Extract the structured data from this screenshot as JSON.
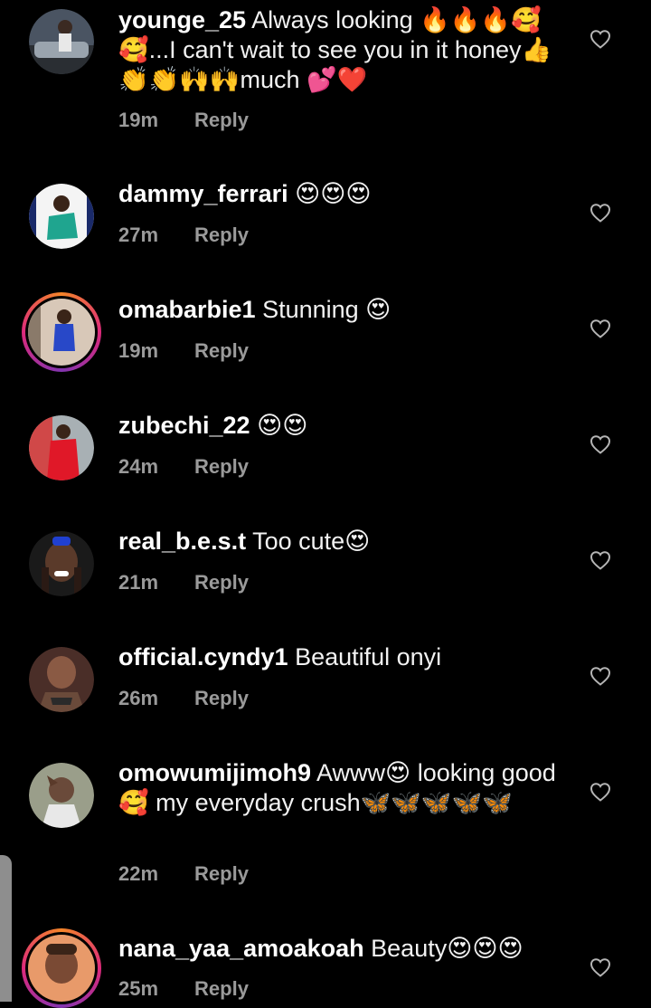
{
  "comments": [
    {
      "username": "younge_25",
      "text": " Always looking 🔥🔥🔥🥰🥰...I can't wait to see you in it honey👍👏👏🙌🙌much 💕❤️",
      "time": "19m",
      "reply": "Reply",
      "avatar_color": "#556070",
      "story_ring": false
    },
    {
      "username": "dammy_ferrari",
      "text": " 😍😍😍",
      "time": "27m",
      "reply": "Reply",
      "avatar_color": "#1fa58f",
      "story_ring": false
    },
    {
      "username": "omabarbie1",
      "text": " Stunning 😍",
      "time": "19m",
      "reply": "Reply",
      "avatar_color": "#2848c8",
      "story_ring": true
    },
    {
      "username": "zubechi_22",
      "text": " 😍😍",
      "time": "24m",
      "reply": "Reply",
      "avatar_color": "#c81e2a",
      "story_ring": false
    },
    {
      "username": "real_b.e.s.t",
      "text": " Too cute😍",
      "time": "21m",
      "reply": "Reply",
      "avatar_color": "#3a2a24",
      "story_ring": false
    },
    {
      "username": "official.cyndy1",
      "text": " Beautiful onyi",
      "time": "26m",
      "reply": "Reply",
      "avatar_color": "#7a4a3a",
      "story_ring": false
    },
    {
      "username": "omowumijimoh9",
      "text": " Awww😍 looking good 🥰 my everyday crush🦋🦋🦋🦋🦋",
      "time": "22m",
      "reply": "Reply",
      "avatar_color": "#8a8f7a",
      "story_ring": false
    },
    {
      "username": "nana_yaa_amoakoah",
      "text": " Beauty😍😍😍",
      "time": "25m",
      "reply": "Reply",
      "avatar_color": "#e08a5a",
      "story_ring": true
    }
  ],
  "icons": {
    "like": "heart-outline-icon"
  }
}
